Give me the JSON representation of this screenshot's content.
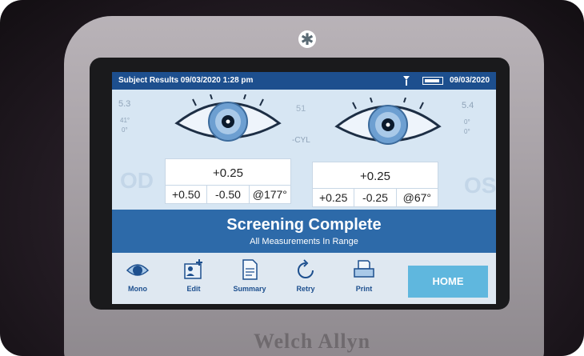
{
  "status": {
    "title": "Subject Results  09/03/2020 1:28 pm",
    "date": "09/03/2020"
  },
  "left_eye": {
    "side_value_top": "5.3",
    "side_value_mid": "41°",
    "side_value_low": "0°",
    "side_label": "OD",
    "sphere": "+0.25",
    "cyl": "+0.50",
    "axis_cyl": "-0.50",
    "axis": "@177°"
  },
  "center": {
    "value": "51",
    "cyl_label": "-CYL"
  },
  "right_eye": {
    "side_value_top": "5.4",
    "side_value_mid": "0°",
    "side_value_low": "0°",
    "side_label": "OS",
    "sphere": "+0.25",
    "cyl": "+0.25",
    "axis_cyl": "-0.25",
    "axis": "@67°"
  },
  "banner": {
    "title": "Screening Complete",
    "subtitle": "All Measurements In Range"
  },
  "toolbar": {
    "mono": "Mono",
    "edit": "Edit",
    "summary": "Summary",
    "retry": "Retry",
    "print": "Print",
    "home": "HOME"
  },
  "device": {
    "brand": "Welch Allyn"
  },
  "colors": {
    "statusbar": "#1d4f8e",
    "banner": "#2d6aa9",
    "home_button": "#5fb7de"
  }
}
